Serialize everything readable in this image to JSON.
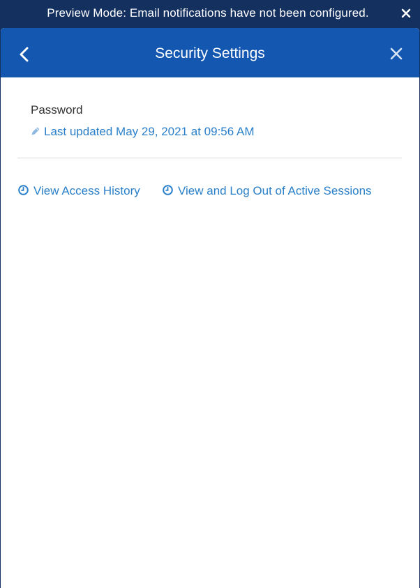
{
  "banner": {
    "message": "Preview Mode: Email notifications have not been configured.",
    "close_icon": "close-icon"
  },
  "dialog": {
    "title": "Security Settings",
    "back_icon": "chevron-left-icon",
    "close_icon": "close-icon"
  },
  "password": {
    "label": "Password",
    "updated_text": "Last updated May 29, 2021 at 09:56 AM",
    "icon": "pencil-icon"
  },
  "actions": {
    "access_history": "View Access History",
    "active_sessions": "View and Log Out of Active Sessions",
    "icon": "clock-icon"
  },
  "colors": {
    "banner_bg": "#14305f",
    "header_bg": "#1357b1",
    "link": "#2a7fc9",
    "text": "#333333"
  }
}
